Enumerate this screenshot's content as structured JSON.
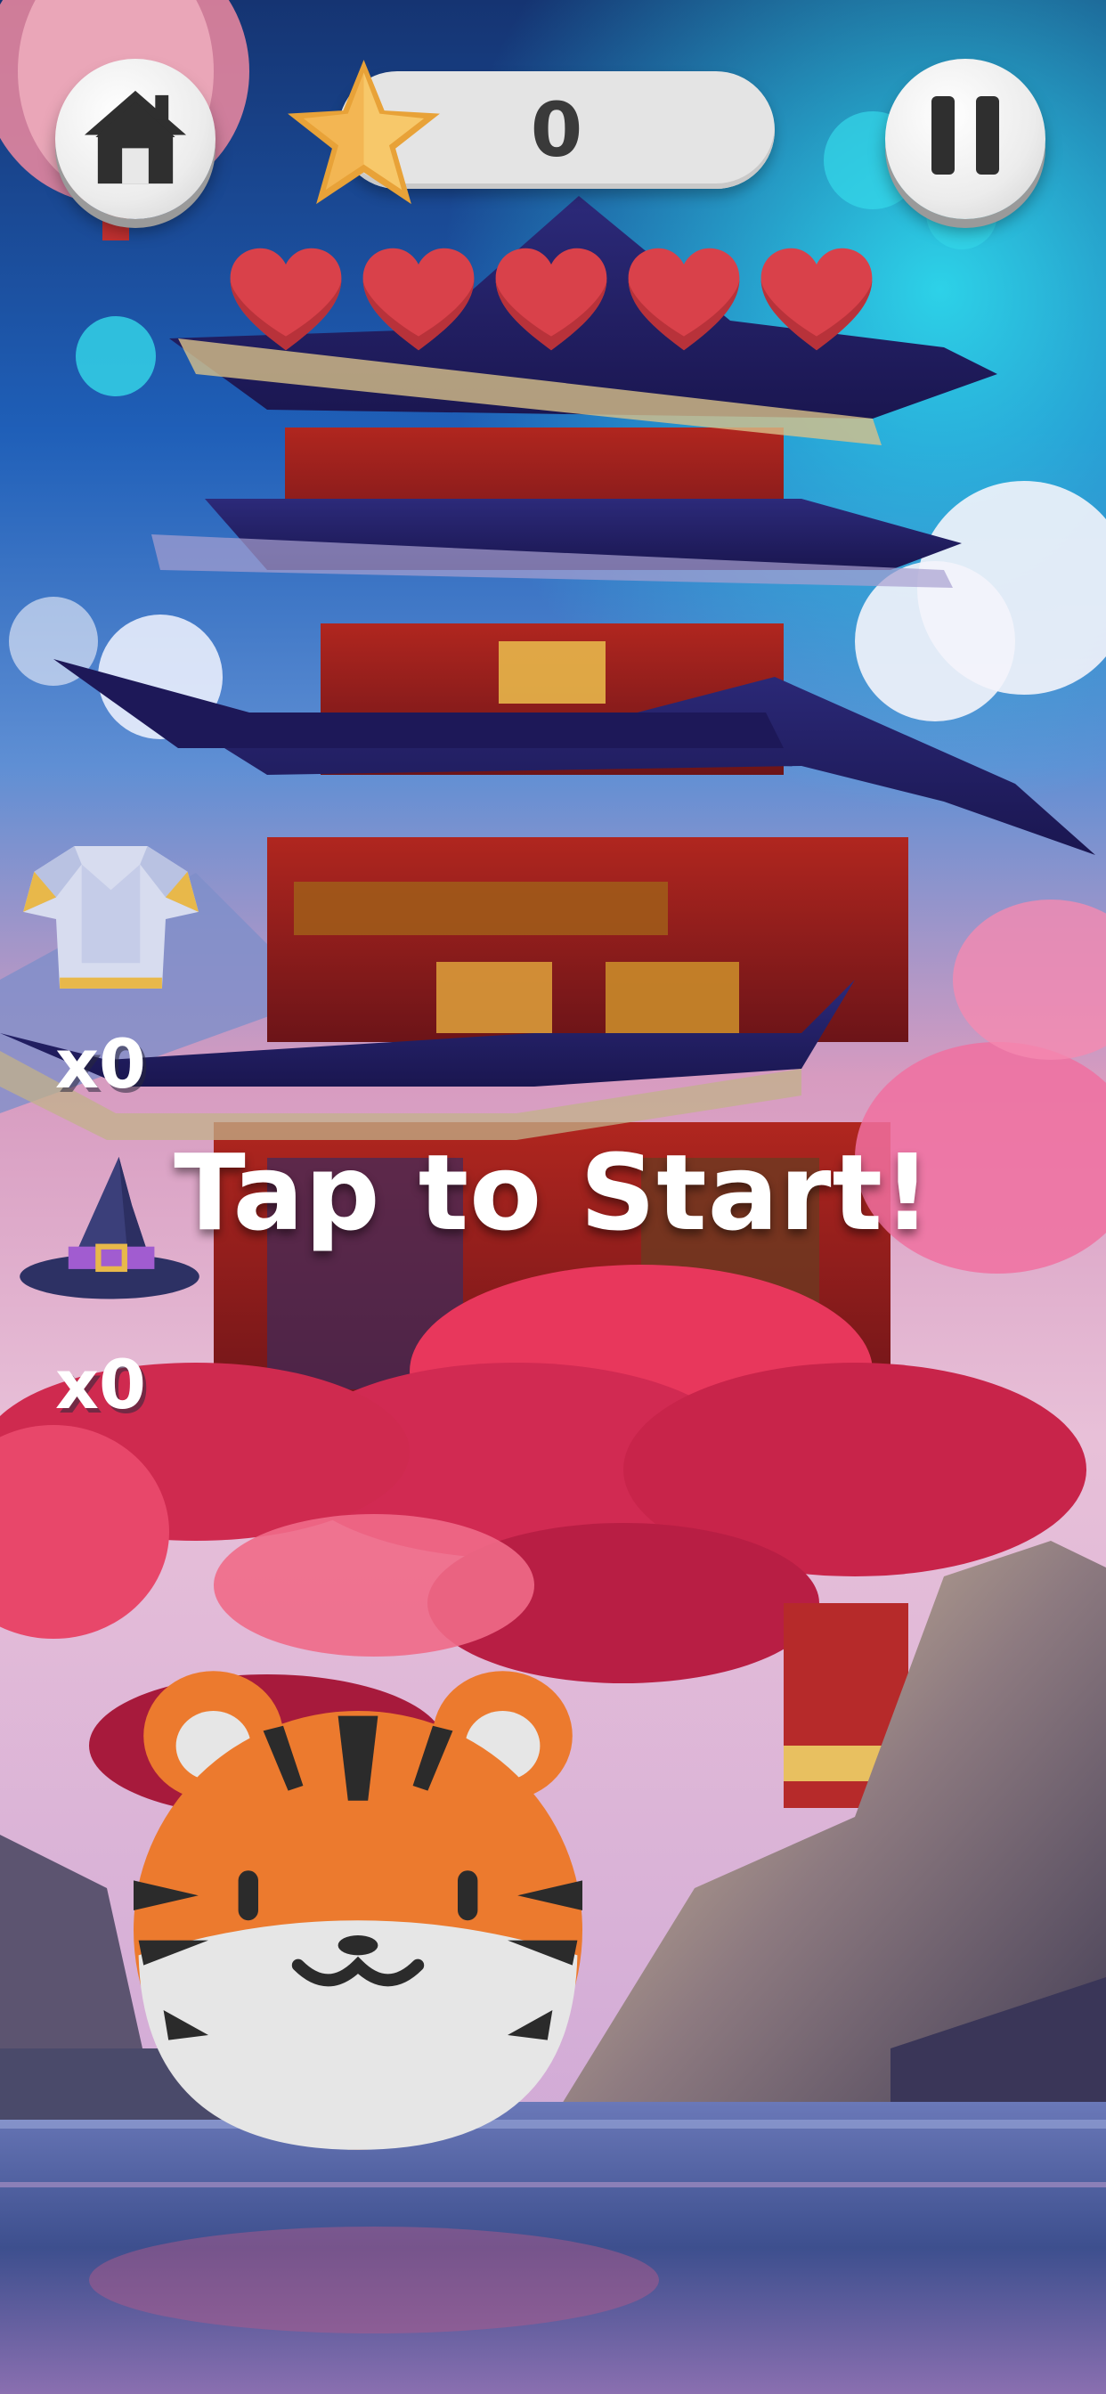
{
  "hud": {
    "home_icon": "home-icon",
    "pause_icon": "pause-icon",
    "star_icon": "star-icon",
    "score": "0",
    "lives": 5,
    "heart_icon": "heart-icon"
  },
  "powerups": [
    {
      "icon": "armor-icon",
      "count": "x0"
    },
    {
      "icon": "wizard-hat-icon",
      "count": "x0"
    }
  ],
  "prompt": {
    "text": "Tap to Start!"
  },
  "player": {
    "icon": "tiger-face-icon"
  },
  "colors": {
    "heart": "#d9414a",
    "star": "#f2b64f",
    "tiger_orange": "#ec7a2e",
    "tiger_stripe": "#2b2b2b",
    "tiger_belly": "#e6e6e6",
    "sky_top": "#1c3f8a",
    "sky_cyan": "#28c7e4",
    "blossom": "#e2375d"
  }
}
